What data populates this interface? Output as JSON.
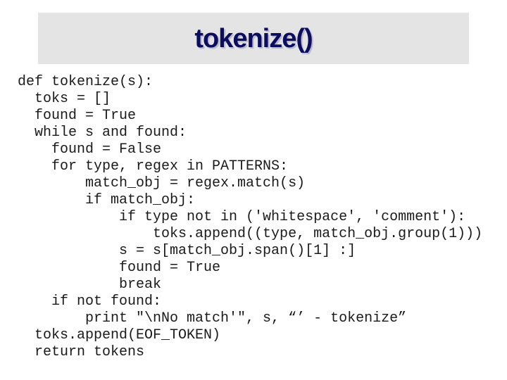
{
  "slide": {
    "title": "tokenize()",
    "colors": {
      "title_text": "#0c0c60",
      "banner_background": "#e4e4e4",
      "code_text": "#1a1a1a"
    },
    "code_lines": [
      "def tokenize(s):",
      "  toks = []",
      "  found = True",
      "  while s and found:",
      "    found = False",
      "    for type, regex in PATTERNS:",
      "        match_obj = regex.match(s)",
      "        if match_obj:",
      "            if type not in ('whitespace', 'comment'):",
      "                toks.append((type, match_obj.group(1)))",
      "            s = s[match_obj.span()[1] :]",
      "            found = True",
      "            break",
      "    if not found:",
      "        print \"\\nNo match'\", s, “’ - tokenize”",
      "  toks.append(EOF_TOKEN)",
      "  return tokens"
    ]
  }
}
